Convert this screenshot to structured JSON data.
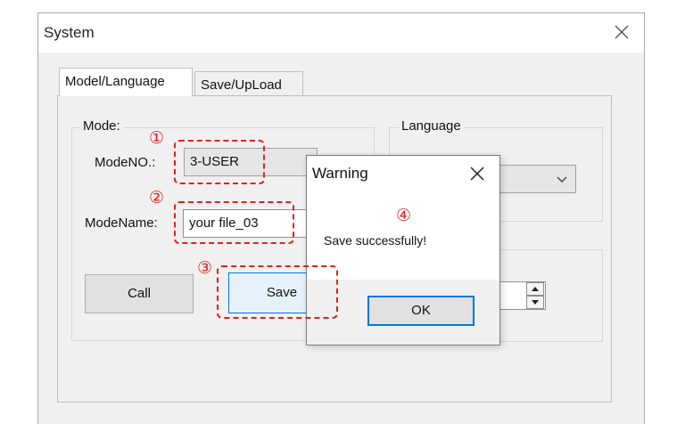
{
  "window": {
    "title": "System"
  },
  "tabs": [
    {
      "label": "Model/Language"
    },
    {
      "label": "Save/UpLoad"
    }
  ],
  "mode_group": {
    "label": "Mode:",
    "mode_no_label": "ModeNO.:",
    "mode_no_value": "3-USER",
    "mode_name_label": "ModeName:",
    "mode_name_value": "your file_03",
    "call_label": "Call",
    "save_label": "Save"
  },
  "language_group": {
    "label": "Language"
  },
  "annotations": [
    "①",
    "②",
    "③",
    "④"
  ],
  "dialog": {
    "title": "Warning",
    "message": "Save successfully!",
    "ok_label": "OK"
  },
  "colors": {
    "annotation": "#e02020",
    "focus": "#0078d7"
  }
}
